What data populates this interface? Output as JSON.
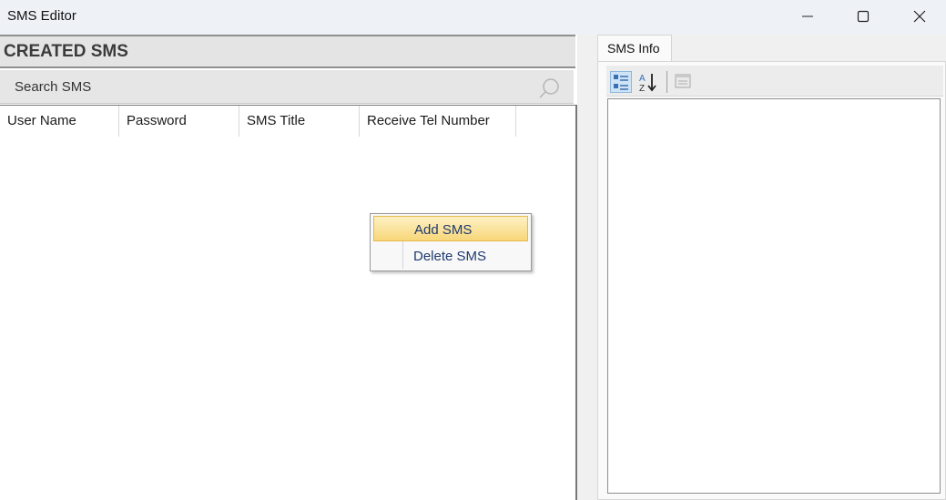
{
  "window": {
    "title": "SMS Editor",
    "minimize": "minimize",
    "maximize": "maximize",
    "close": "close"
  },
  "left_panel": {
    "header": "CREATED SMS",
    "search_placeholder": "Search SMS",
    "columns": [
      "User Name",
      "Password",
      "SMS Title",
      "Receive Tel Number"
    ],
    "rows": []
  },
  "context_menu": {
    "items": [
      {
        "label": "Add SMS",
        "highlighted": true
      },
      {
        "label": "Delete SMS",
        "highlighted": false
      }
    ]
  },
  "right_panel": {
    "tab_label": "SMS Info",
    "toolbar": {
      "categorized_icon": "categorized-icon",
      "sort_az_icon": "sort-alphabetical-icon",
      "property_pages_icon": "property-pages-icon"
    }
  },
  "colors": {
    "menu_highlight": "#f8d77a",
    "menu_text": "#1e3a6e",
    "header_bg": "#e4e4e4"
  }
}
